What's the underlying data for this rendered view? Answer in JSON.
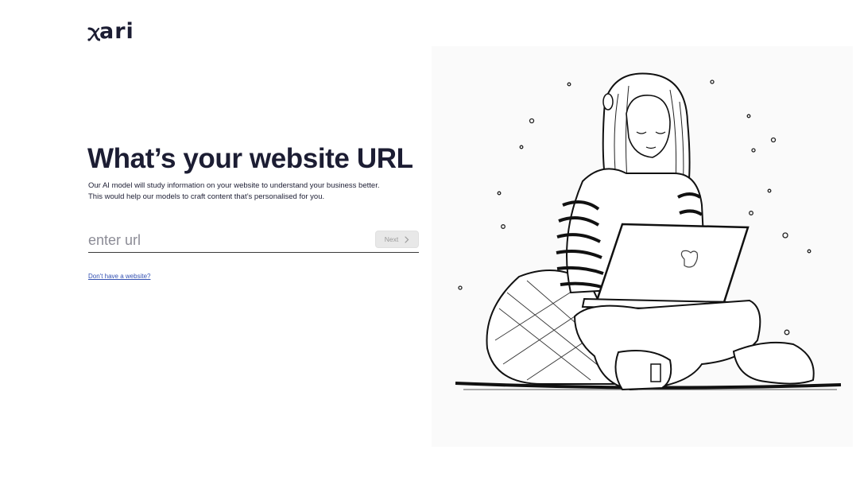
{
  "brand": {
    "logo_text": "ari"
  },
  "main": {
    "title": "What’s your website URL",
    "description_line1": "Our AI model will study information on your website to understand your business better.",
    "description_line2": "This would help our models to craft content that’s personalised for you."
  },
  "url_field": {
    "placeholder": "enter url",
    "value": ""
  },
  "next_button": {
    "label": "Next",
    "state": "disabled"
  },
  "no_website_link": {
    "label": "Don't have a website?"
  },
  "colors": {
    "text": "#1c1d33",
    "link": "#3451b2",
    "button_bg": "#e8e8e8",
    "button_text": "#9a9a9a"
  },
  "illustration": {
    "subject": "girl-with-laptop-illustration"
  }
}
